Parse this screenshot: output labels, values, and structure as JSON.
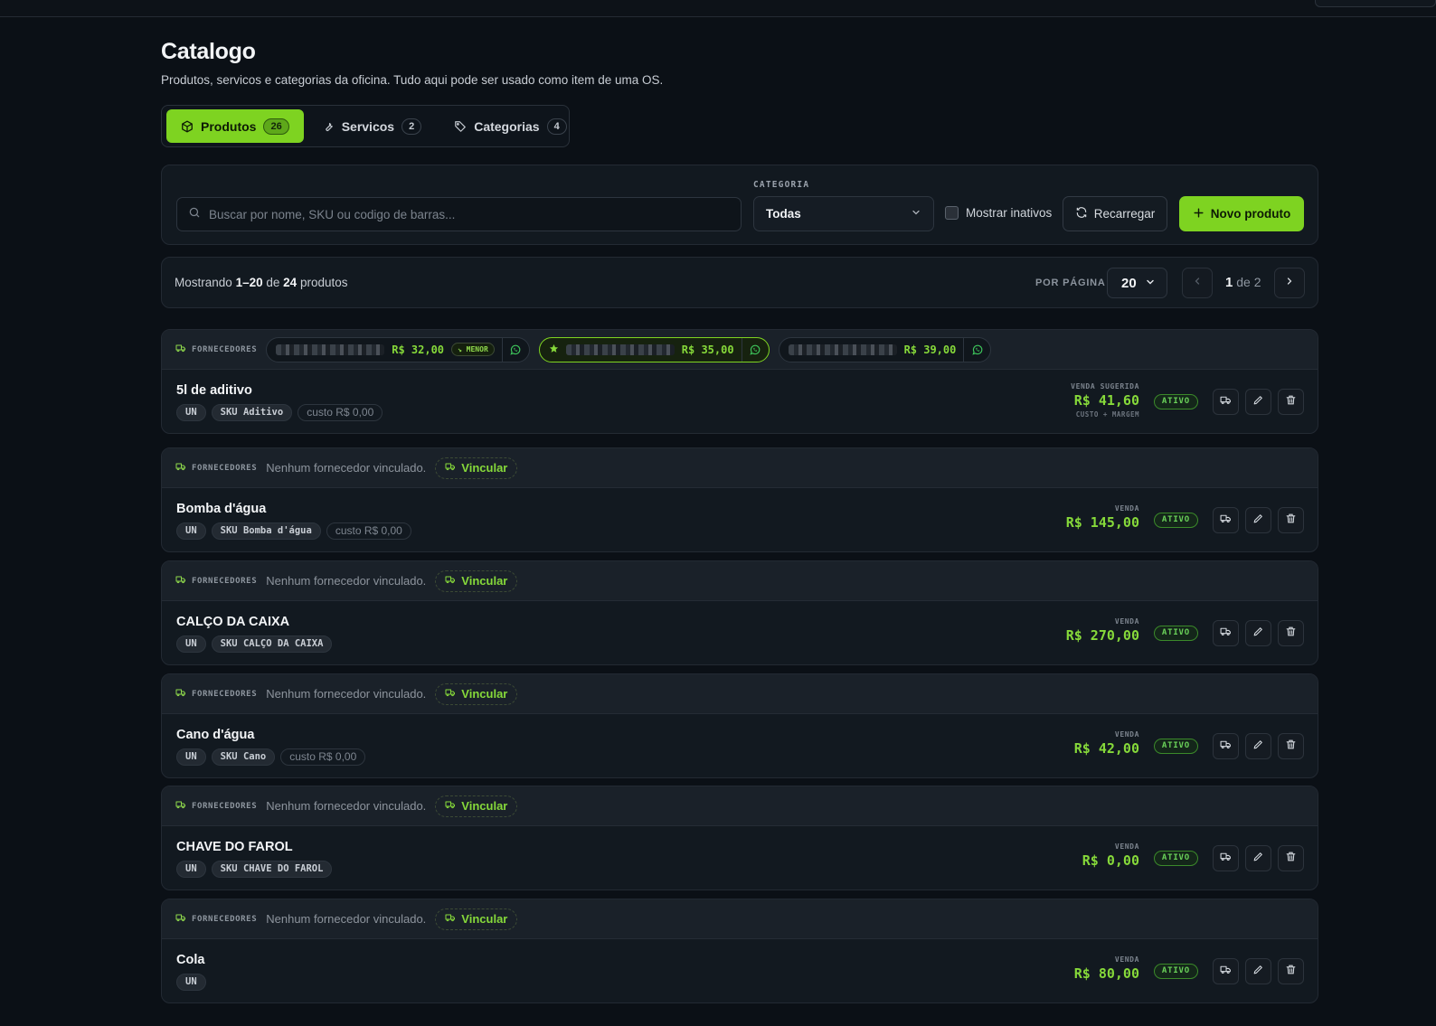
{
  "header": {
    "title": "Catalogo",
    "subtitle": "Produtos, servicos e categorias da oficina. Tudo aqui pode ser usado como item de uma OS."
  },
  "tabs": [
    {
      "label": "Produtos",
      "count": "26",
      "icon": "box-icon",
      "active": true
    },
    {
      "label": "Servicos",
      "count": "2",
      "icon": "wrench-icon",
      "active": false
    },
    {
      "label": "Categorias",
      "count": "4",
      "icon": "tag-icon",
      "active": false
    }
  ],
  "filters": {
    "search_placeholder": "Buscar por nome, SKU ou codigo de barras...",
    "category_label": "CATEGORIA",
    "category_value": "Todas",
    "show_inactive_label": "Mostrar inativos",
    "show_inactive_checked": false,
    "reload_label": "Recarregar",
    "new_product_label": "Novo produto"
  },
  "pagination": {
    "showing_prefix": "Mostrando",
    "range": "1–20",
    "of_word": "de",
    "total": "24",
    "unit": "produtos",
    "per_page_label": "POR PÁGINA",
    "per_page_value": "20",
    "current_page": "1",
    "total_pages": "2"
  },
  "labels": {
    "suppliers": "FORNECEDORES",
    "no_supplier": "Nenhum fornecedor vinculado.",
    "link_supplier": "Vincular",
    "lowest": "MENOR",
    "sale": "VENDA",
    "sale_suggested": "VENDA SUGERIDA",
    "cost_plus_margin": "CUSTO + MARGEM"
  },
  "products": [
    {
      "name": "5l de aditivo",
      "unit": "UN",
      "sku": "SKU Aditivo",
      "cost": "custo R$ 0,00",
      "price": "R$ 41,60",
      "suggested": true,
      "status": "ATIVO",
      "suppliers": [
        {
          "price": "R$ 32,00",
          "lowest": true,
          "best": false
        },
        {
          "price": "R$ 35,00",
          "lowest": false,
          "best": true
        },
        {
          "price": "R$ 39,00",
          "lowest": false,
          "best": false
        }
      ]
    },
    {
      "name": "Bomba d'água",
      "unit": "UN",
      "sku": "SKU Bomba d'água",
      "cost": "custo R$ 0,00",
      "price": "R$ 145,00",
      "suggested": false,
      "status": "ATIVO",
      "suppliers": []
    },
    {
      "name": "CALÇO DA CAIXA",
      "unit": "UN",
      "sku": "SKU CALÇO DA CAIXA",
      "cost": "",
      "price": "R$ 270,00",
      "suggested": false,
      "status": "ATIVO",
      "suppliers": []
    },
    {
      "name": "Cano d'água",
      "unit": "UN",
      "sku": "SKU Cano",
      "cost": "custo R$ 0,00",
      "price": "R$ 42,00",
      "suggested": false,
      "status": "ATIVO",
      "suppliers": []
    },
    {
      "name": "CHAVE DO FAROL",
      "unit": "UN",
      "sku": "SKU CHAVE DO FAROL",
      "cost": "",
      "price": "R$ 0,00",
      "suggested": false,
      "status": "ATIVO",
      "suppliers": []
    },
    {
      "name": "Cola",
      "unit": "UN",
      "sku": "",
      "cost": "",
      "price": "R$ 80,00",
      "suggested": false,
      "status": "ATIVO",
      "suppliers": []
    }
  ],
  "colors": {
    "accent": "#7ed321",
    "background": "#0b1016",
    "card": "#121920",
    "status_active": "#6bd35a"
  }
}
